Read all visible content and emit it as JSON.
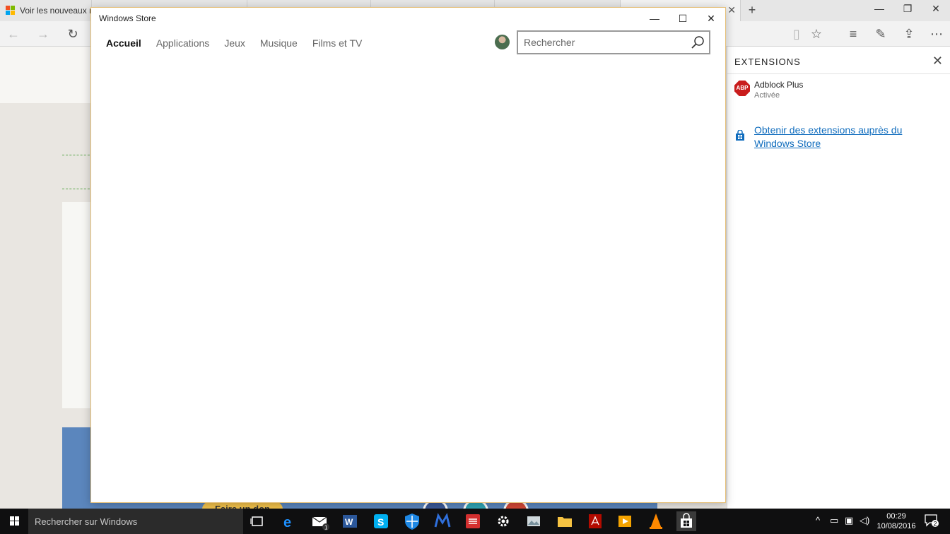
{
  "browser": {
    "tabs": [
      {
        "title": "Voir les nouveaux m",
        "active": false
      },
      {
        "title": "",
        "active": false
      },
      {
        "title": "",
        "active": false
      },
      {
        "title": "",
        "active": false
      },
      {
        "title": "",
        "active": false
      },
      {
        "title": "",
        "active": true
      }
    ],
    "colors": {
      "link": "#0f6cbd",
      "abp_red": "#c91c1c",
      "window_border": "#e5c07a"
    }
  },
  "page": {
    "donate_label": "Faire un don"
  },
  "extensions_panel": {
    "title": "EXTENSIONS",
    "items": [
      {
        "name": "Adblock Plus",
        "status": "Activée",
        "icon_text": "ABP"
      }
    ],
    "store_link": "Obtenir des extensions auprès du Windows Store"
  },
  "store_window": {
    "title": "Windows Store",
    "nav": [
      {
        "label": "Accueil",
        "active": true
      },
      {
        "label": "Applications",
        "active": false
      },
      {
        "label": "Jeux",
        "active": false
      },
      {
        "label": "Musique",
        "active": false
      },
      {
        "label": "Films et TV",
        "active": false
      }
    ],
    "search_placeholder": "Rechercher"
  },
  "taskbar": {
    "search_text": "Rechercher sur Windows",
    "time": "00:29",
    "date": "10/08/2016",
    "mail_badge": "1",
    "notification_count": "2"
  }
}
